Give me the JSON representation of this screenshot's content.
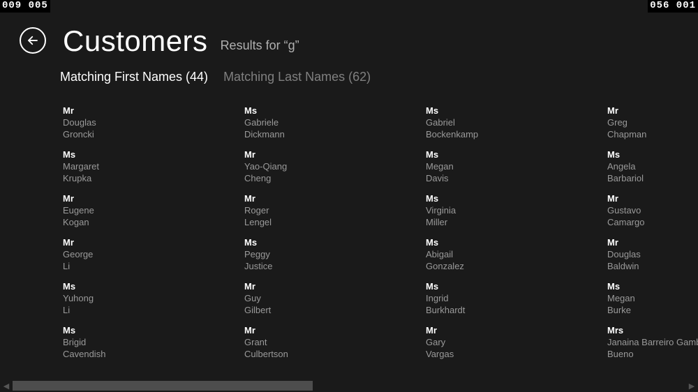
{
  "counters": {
    "top_left": "009 005",
    "top_right": "056 001"
  },
  "header": {
    "title": "Customers",
    "subtitle": "Results for “g”"
  },
  "tabs": {
    "first": {
      "label": "Matching First Names",
      "count": 44
    },
    "last": {
      "label": "Matching Last Names",
      "count": 62
    }
  },
  "columns": [
    [
      {
        "title": "Mr",
        "first": "Douglas",
        "last": "Groncki"
      },
      {
        "title": "Ms",
        "first": "Margaret",
        "last": "Krupka"
      },
      {
        "title": "Mr",
        "first": "Eugene",
        "last": "Kogan"
      },
      {
        "title": "Mr",
        "first": "George",
        "last": "Li"
      },
      {
        "title": "Ms",
        "first": "Yuhong",
        "last": "Li"
      },
      {
        "title": "Ms",
        "first": "Brigid",
        "last": "Cavendish"
      }
    ],
    [
      {
        "title": "Ms",
        "first": "Gabriele",
        "last": "Dickmann"
      },
      {
        "title": "Mr",
        "first": "Yao-Qiang",
        "last": "Cheng"
      },
      {
        "title": "Mr",
        "first": "Roger",
        "last": "Lengel"
      },
      {
        "title": "Ms",
        "first": "Peggy",
        "last": "Justice"
      },
      {
        "title": "Mr",
        "first": "Guy",
        "last": "Gilbert"
      },
      {
        "title": "Mr",
        "first": "Grant",
        "last": "Culbertson"
      }
    ],
    [
      {
        "title": "Ms",
        "first": "Gabriel",
        "last": "Bockenkamp"
      },
      {
        "title": "Ms",
        "first": "Megan",
        "last": "Davis"
      },
      {
        "title": "Ms",
        "first": "Virginia",
        "last": "Miller"
      },
      {
        "title": "Ms",
        "first": "Abigail",
        "last": "Gonzalez"
      },
      {
        "title": "Ms",
        "first": "Ingrid",
        "last": "Burkhardt"
      },
      {
        "title": "Mr",
        "first": "Gary",
        "last": "Vargas"
      }
    ],
    [
      {
        "title": "Mr",
        "first": "Greg",
        "last": "Chapman"
      },
      {
        "title": "Ms",
        "first": "Angela",
        "last": "Barbariol"
      },
      {
        "title": "Mr",
        "first": "Gustavo",
        "last": "Camargo"
      },
      {
        "title": "Mr",
        "first": "Douglas",
        "last": "Baldwin"
      },
      {
        "title": "Ms",
        "first": "Megan",
        "last": "Burke"
      },
      {
        "title": "Mrs",
        "first": "Janaina Barreiro Gambaro",
        "last": "Bueno"
      }
    ]
  ]
}
